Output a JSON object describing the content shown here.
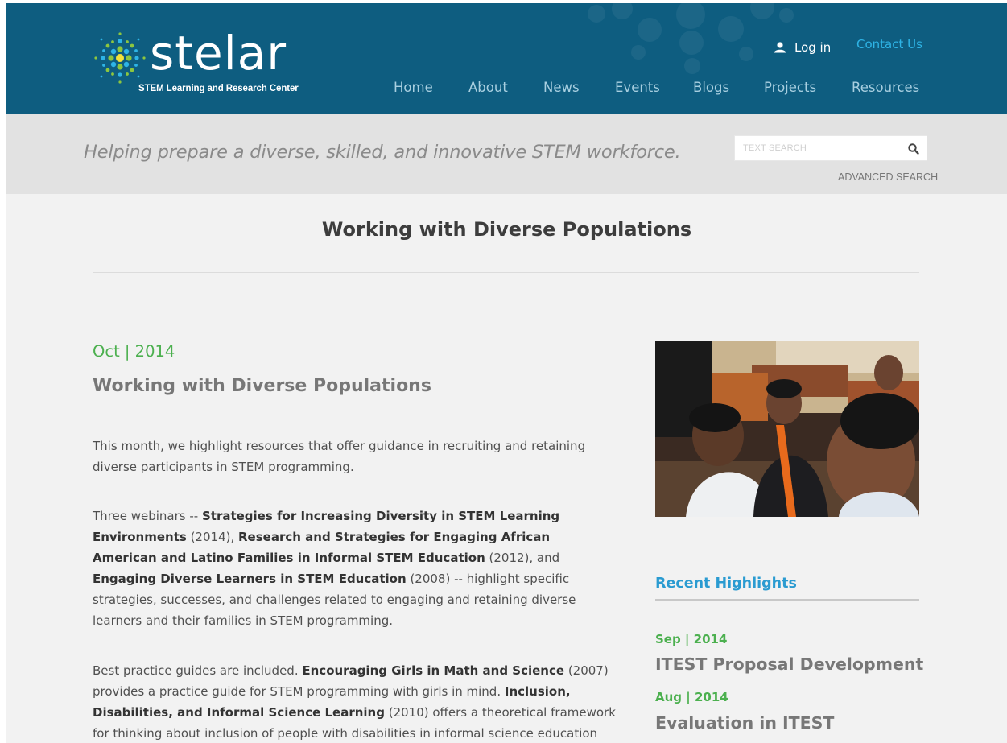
{
  "header": {
    "logo_text": "stelar",
    "logo_subtitle": "STEM Learning and Research Center",
    "login_label": "Log in",
    "contact_label": "Contact Us",
    "nav": [
      "Home",
      "About",
      "News",
      "Events",
      "Blogs",
      "Projects",
      "Resources"
    ]
  },
  "band": {
    "tagline": "Helping prepare a diverse, skilled, and innovative STEM workforce.",
    "search_placeholder": "TEXT SEARCH",
    "advanced_search_label": "ADVANCED SEARCH"
  },
  "main": {
    "page_title": "Working with Diverse Populations",
    "article": {
      "date": "Oct | 2014",
      "title": "Working with Diverse Populations",
      "p1": "This month, we highlight resources that offer guidance in recruiting and retaining diverse participants in STEM programming.",
      "p2": {
        "intro": "Three webinars -- ",
        "w1": "Strategies for Increasing Diversity in STEM Learning Environments",
        "w1_year": " (2014), ",
        "w2": "Research and Strategies for Engaging African American and Latino Families in Informal STEM Education",
        "w2_year": " (2012), and ",
        "w3": "Engaging Diverse Learners in STEM Education",
        "w3_year": " (2008) -- highlight specific strategies, successes, and challenges related to engaging and retaining diverse learners and their families in STEM programming."
      },
      "p3": {
        "intro": "Best practice guides are included. ",
        "g1": "Encouraging Girls in Math and Science",
        "g1_rest": " (2007) provides a practice guide for STEM programming with girls in mind.  ",
        "g2": "Inclusion, Disabilities, and Informal Science Learning",
        "g2_rest": " (2010) offers a theoretical framework for thinking about inclusion of people with disabilities in informal science education"
      }
    },
    "sidebar": {
      "heading": "Recent Highlights",
      "highlights": [
        {
          "date": "Sep | 2014",
          "title": "ITEST Proposal Development"
        },
        {
          "date": "Aug | 2014",
          "title": "Evaluation in ITEST"
        }
      ]
    }
  }
}
